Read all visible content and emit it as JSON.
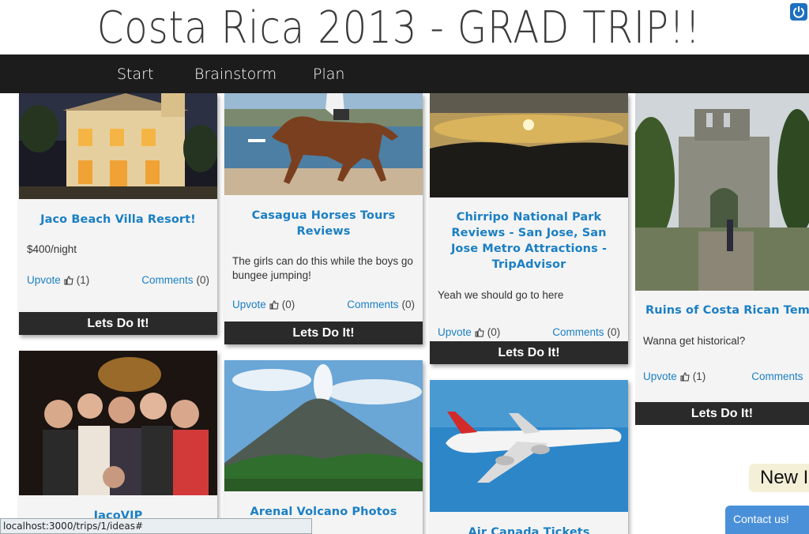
{
  "app": {
    "title": "Costa Rica 2013 - GRAD TRIP!!"
  },
  "nav": {
    "tabs": [
      {
        "label": "Start"
      },
      {
        "label": "Brainstorm"
      },
      {
        "label": "Plan"
      }
    ]
  },
  "cards": [
    {
      "title": "Jaco Beach Villa Resort!",
      "description": "$400/night",
      "upvote_label": "Upvote",
      "upvotes": "(1)",
      "comments_label": "Comments",
      "comments": "(0)",
      "action_label": "Lets Do It!",
      "image": "villa-photo"
    },
    {
      "title": "Casagua Horses Tours Reviews",
      "description": "The girls can do this while the boys go bungee jumping!",
      "upvote_label": "Upvote",
      "upvotes": "(0)",
      "comments_label": "Comments",
      "comments": "(0)",
      "action_label": "Lets Do It!",
      "image": "horse-beach-photo"
    },
    {
      "title": "Chirripo National Park Reviews - San Jose, San Jose Metro Attractions - TripAdvisor",
      "description": "Yeah we should go to here",
      "upvote_label": "Upvote",
      "upvotes": "(0)",
      "comments_label": "Comments",
      "comments": "(0)",
      "action_label": "Lets Do It!",
      "image": "sunset-photo"
    },
    {
      "title": "Ruins of Costa Rican Temp",
      "description": "Wanna get historical?",
      "upvote_label": "Upvote",
      "upvotes": "(1)",
      "comments_label": "Comments",
      "comments": "",
      "action_label": "Lets Do It!",
      "image": "ruins-photo"
    },
    {
      "title": "JacoVIP",
      "image": "party-photo"
    },
    {
      "title": "Arenal Volcano Photos",
      "image": "volcano-photo"
    },
    {
      "title": "Air Canada Tickets",
      "image": "airplane-photo"
    }
  ],
  "new_badge": "New I",
  "contact_label": "Contact us!",
  "status_url": "localhost:3000/trips/1/ideas#",
  "colors": {
    "nav_bg": "#1c1c1c",
    "link": "#1a7fc4",
    "action_bg": "#2a2a2a",
    "contact_bg": "#4a90d9"
  }
}
